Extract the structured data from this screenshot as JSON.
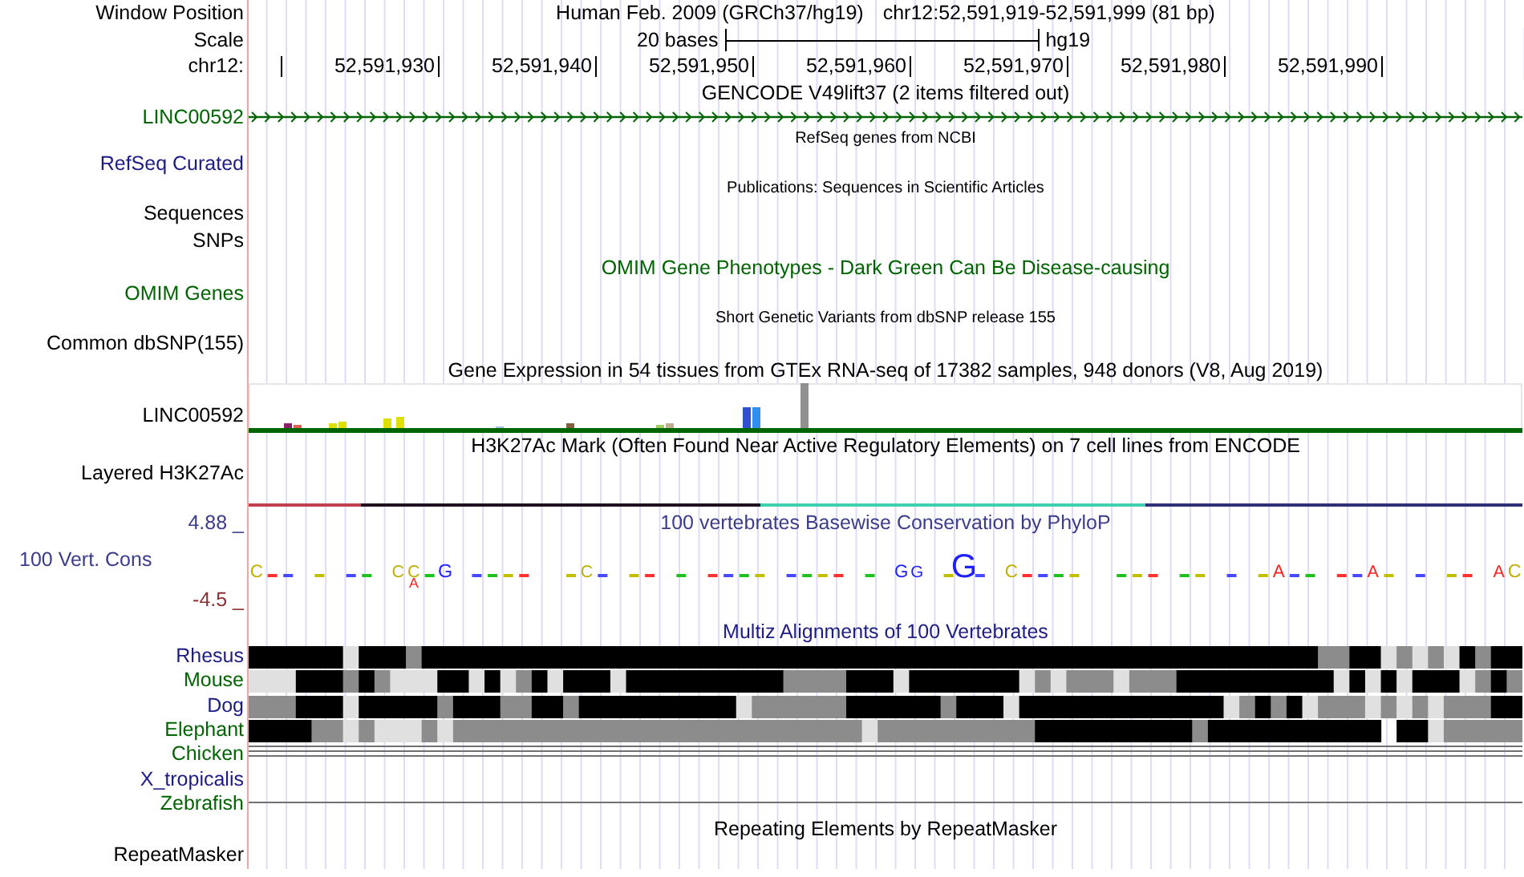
{
  "position": {
    "label": "Window Position",
    "assembly": "Human Feb. 2009 (GRCh37/hg19)",
    "range": "chr12:52,591,919-52,591,999 (81 bp)"
  },
  "scale": {
    "label": "Scale",
    "text": "20 bases",
    "db": "hg19"
  },
  "ruler": {
    "label": "chr12:",
    "ticks": [
      "52,591,930",
      "52,591,940",
      "52,591,950",
      "52,591,960",
      "52,591,970",
      "52,591,980",
      "52,591,990"
    ]
  },
  "tracks": [
    {
      "kind": "gene",
      "title": {
        "text": "GENCODE V49lift37 (2 items filtered out)",
        "color": "#000000",
        "small": false
      },
      "labels": [
        {
          "text": "LINC00592",
          "color": "#006400"
        }
      ]
    },
    {
      "kind": "empty",
      "title": {
        "text": "RefSeq genes from NCBI",
        "color": "#000000",
        "small": true
      },
      "labels": [
        {
          "text": "RefSeq Curated",
          "color": "#1c1c84"
        }
      ]
    },
    {
      "kind": "empty",
      "title": {
        "text": "Publications: Sequences in Scientific Articles",
        "color": "#000000",
        "small": true
      },
      "labels": [
        {
          "text": "Sequences",
          "color": "#000000"
        },
        {
          "text": "SNPs",
          "color": "#000000"
        }
      ]
    },
    {
      "kind": "empty",
      "title": {
        "text": "OMIM Gene Phenotypes - Dark Green Can Be Disease-causing",
        "color": "#006400",
        "small": false
      },
      "labels": [
        {
          "text": "OMIM Genes",
          "color": "#006400"
        }
      ]
    },
    {
      "kind": "empty",
      "title": {
        "text": "Short Genetic Variants from dbSNP release 155",
        "color": "#000000",
        "small": true
      },
      "labels": [
        {
          "text": "Common dbSNP(155)",
          "color": "#000000"
        }
      ]
    },
    {
      "kind": "expression",
      "title": {
        "text": "Gene Expression in 54 tissues from GTEx RNA-seq of 17382 samples, 948 donors (V8, Aug 2019)",
        "color": "#000000",
        "small": false
      },
      "labels": [
        {
          "text": "LINC00592",
          "color": "#000000"
        }
      ]
    },
    {
      "kind": "signal",
      "title": {
        "text": "H3K27Ac Mark (Often Found Near Active Regulatory Elements) on 7 cell lines from ENCODE",
        "color": "#000000",
        "small": false
      },
      "labels": [
        {
          "text": "Layered H3K27Ac",
          "color": "#000000"
        }
      ]
    },
    {
      "kind": "conservation",
      "title": {
        "text": "100 vertebrates Basewise Conservation by PhyloP",
        "color": "#3c3c8c",
        "small": false
      },
      "labels": [
        {
          "text": "4.88 _",
          "color": "#3c3c8c"
        },
        {
          "text": "100 Vert. Cons",
          "color": "#3c3c8c"
        },
        {
          "text": "-4.5 _",
          "color": "#8b3030"
        }
      ],
      "letters": [
        "C",
        "C",
        "C",
        "A",
        "G",
        "C",
        "G",
        "G",
        "G",
        "C",
        "A",
        "A",
        "A",
        "C"
      ]
    },
    {
      "kind": "alignment",
      "title": {
        "text": "Multiz Alignments of 100 Vertebrates",
        "color": "#1c1c84",
        "small": false
      },
      "labels": [
        {
          "text": "Rhesus",
          "color": "#1c1c84",
          "kind": "blocks"
        },
        {
          "text": "Mouse",
          "color": "#006400",
          "kind": "blocks"
        },
        {
          "text": "Dog",
          "color": "#1c1c84",
          "kind": "blocks"
        },
        {
          "text": "Elephant",
          "color": "#006400",
          "kind": "blocks"
        },
        {
          "text": "Chicken",
          "color": "#006400",
          "kind": "double-line"
        },
        {
          "text": "X_tropicalis",
          "color": "#1c1c84",
          "kind": "none"
        },
        {
          "text": "Zebrafish",
          "color": "#006400",
          "kind": "line"
        }
      ]
    },
    {
      "kind": "empty",
      "title": {
        "text": "Repeating Elements by RepeatMasker",
        "color": "#000000",
        "small": false
      },
      "labels": [
        {
          "text": "RepeatMasker",
          "color": "#000000"
        }
      ]
    }
  ]
}
